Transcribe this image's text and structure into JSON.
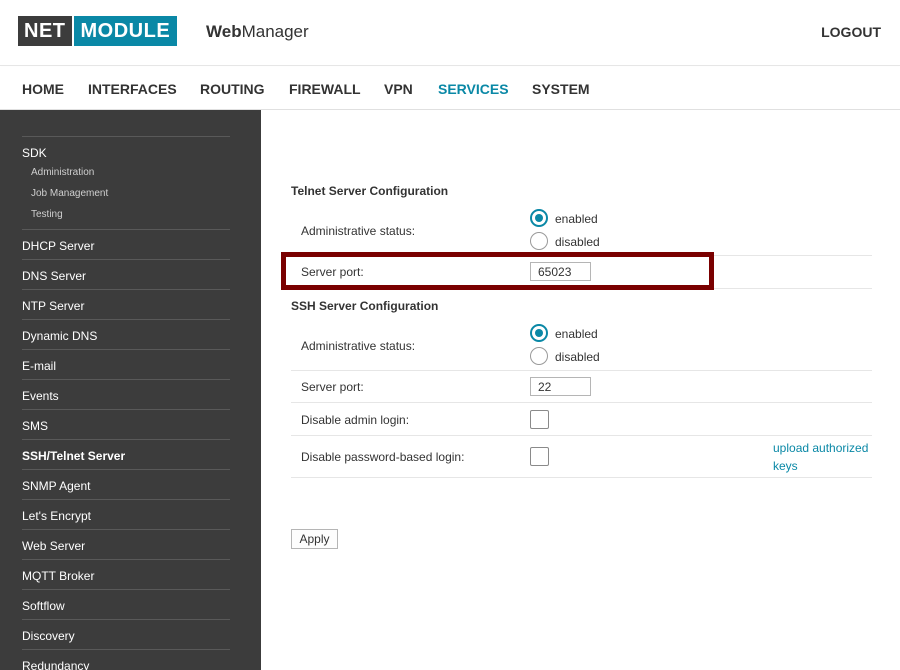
{
  "header": {
    "logo_net": "NET",
    "logo_module": "MODULE",
    "brand_bold": "Web",
    "brand_rest": "Manager",
    "logout": "LOGOUT"
  },
  "nav": {
    "items": [
      "HOME",
      "INTERFACES",
      "ROUTING",
      "FIREWALL",
      "VPN",
      "SERVICES",
      "SYSTEM"
    ],
    "active": "SERVICES"
  },
  "sidebar": {
    "sdk": "SDK",
    "sdk_sub": [
      "Administration",
      "Job Management",
      "Testing"
    ],
    "items": [
      "DHCP Server",
      "DNS Server",
      "NTP Server",
      "Dynamic DNS",
      "E-mail",
      "Events",
      "SMS",
      "SSH/Telnet Server",
      "SNMP Agent",
      "Let's Encrypt",
      "Web Server",
      "MQTT Broker",
      "Softflow",
      "Discovery",
      "Redundancy"
    ],
    "active": "SSH/Telnet Server"
  },
  "telnet": {
    "title": "Telnet Server Configuration",
    "status_label": "Administrative status:",
    "enabled": "enabled",
    "disabled": "disabled",
    "port_label": "Server port:",
    "port_value": "65023"
  },
  "ssh": {
    "title": "SSH Server Configuration",
    "status_label": "Administrative status:",
    "enabled": "enabled",
    "disabled": "disabled",
    "port_label": "Server port:",
    "port_value": "22",
    "disable_admin_label": "Disable admin login:",
    "disable_password_label": "Disable password-based login:",
    "upload_link": "upload authorized keys"
  },
  "apply": "Apply",
  "colors": {
    "accent": "#0a88a6",
    "sidebar_bg": "#3c3c3c",
    "highlight": "#7a0000"
  }
}
